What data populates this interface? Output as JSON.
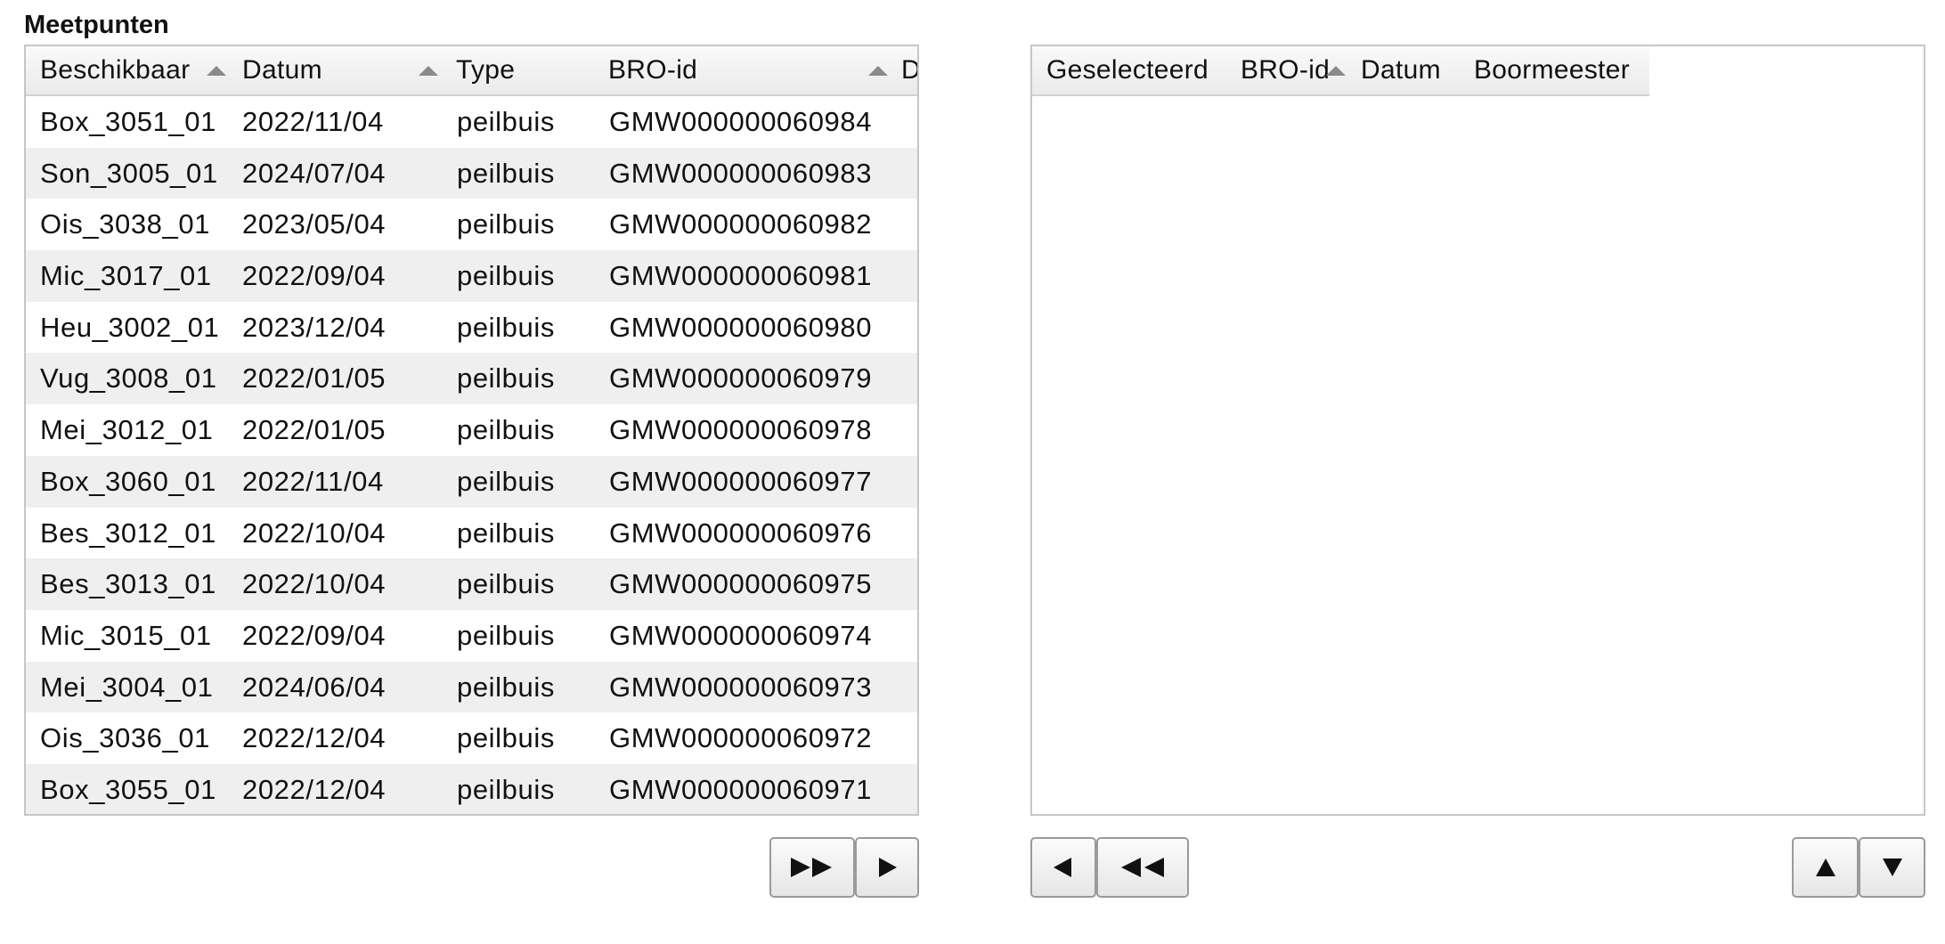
{
  "section": {
    "title": "Meetpunten"
  },
  "left_table": {
    "columns": [
      {
        "key": "beschikbaar",
        "label": "Beschikbaar",
        "sorted": true
      },
      {
        "key": "datum",
        "label": "Datum",
        "sorted": true
      },
      {
        "key": "type",
        "label": "Type",
        "sorted": false
      },
      {
        "key": "bro_id",
        "label": "BRO-id",
        "sorted": true
      },
      {
        "key": "d",
        "label": "D",
        "sorted": false
      }
    ],
    "rows": [
      {
        "beschikbaar": "Box_3051_01",
        "datum": "2022/11/04",
        "type": "peilbuis",
        "bro_id": "GMW000000060984"
      },
      {
        "beschikbaar": "Son_3005_01",
        "datum": "2024/07/04",
        "type": "peilbuis",
        "bro_id": "GMW000000060983"
      },
      {
        "beschikbaar": "Ois_3038_01",
        "datum": "2023/05/04",
        "type": "peilbuis",
        "bro_id": "GMW000000060982"
      },
      {
        "beschikbaar": "Mic_3017_01",
        "datum": "2022/09/04",
        "type": "peilbuis",
        "bro_id": "GMW000000060981"
      },
      {
        "beschikbaar": "Heu_3002_01",
        "datum": "2023/12/04",
        "type": "peilbuis",
        "bro_id": "GMW000000060980"
      },
      {
        "beschikbaar": "Vug_3008_01",
        "datum": "2022/01/05",
        "type": "peilbuis",
        "bro_id": "GMW000000060979"
      },
      {
        "beschikbaar": "Mei_3012_01",
        "datum": "2022/01/05",
        "type": "peilbuis",
        "bro_id": "GMW000000060978"
      },
      {
        "beschikbaar": "Box_3060_01",
        "datum": "2022/11/04",
        "type": "peilbuis",
        "bro_id": "GMW000000060977"
      },
      {
        "beschikbaar": "Bes_3012_01",
        "datum": "2022/10/04",
        "type": "peilbuis",
        "bro_id": "GMW000000060976"
      },
      {
        "beschikbaar": "Bes_3013_01",
        "datum": "2022/10/04",
        "type": "peilbuis",
        "bro_id": "GMW000000060975"
      },
      {
        "beschikbaar": "Mic_3015_01",
        "datum": "2022/09/04",
        "type": "peilbuis",
        "bro_id": "GMW000000060974"
      },
      {
        "beschikbaar": "Mei_3004_01",
        "datum": "2024/06/04",
        "type": "peilbuis",
        "bro_id": "GMW000000060973"
      },
      {
        "beschikbaar": "Ois_3036_01",
        "datum": "2022/12/04",
        "type": "peilbuis",
        "bro_id": "GMW000000060972"
      },
      {
        "beschikbaar": "Box_3055_01",
        "datum": "2022/12/04",
        "type": "peilbuis",
        "bro_id": "GMW000000060971"
      }
    ]
  },
  "right_table": {
    "columns": [
      {
        "key": "geselecteerd",
        "label": "Geselecteerd",
        "sorted": false
      },
      {
        "key": "bro_id",
        "label": "BRO-id",
        "sorted": true
      },
      {
        "key": "datum",
        "label": "Datum",
        "sorted": false
      },
      {
        "key": "boormeester",
        "label": "Boormeester",
        "sorted": false
      }
    ],
    "rows": []
  },
  "buttons": {
    "add_all": {
      "icon": "double-right-arrow-icon"
    },
    "add_selected": {
      "icon": "right-arrow-icon"
    },
    "remove_selected": {
      "icon": "left-arrow-icon"
    },
    "remove_all": {
      "icon": "double-left-arrow-icon"
    },
    "move_up": {
      "icon": "up-arrow-icon"
    },
    "move_down": {
      "icon": "down-arrow-icon"
    }
  }
}
